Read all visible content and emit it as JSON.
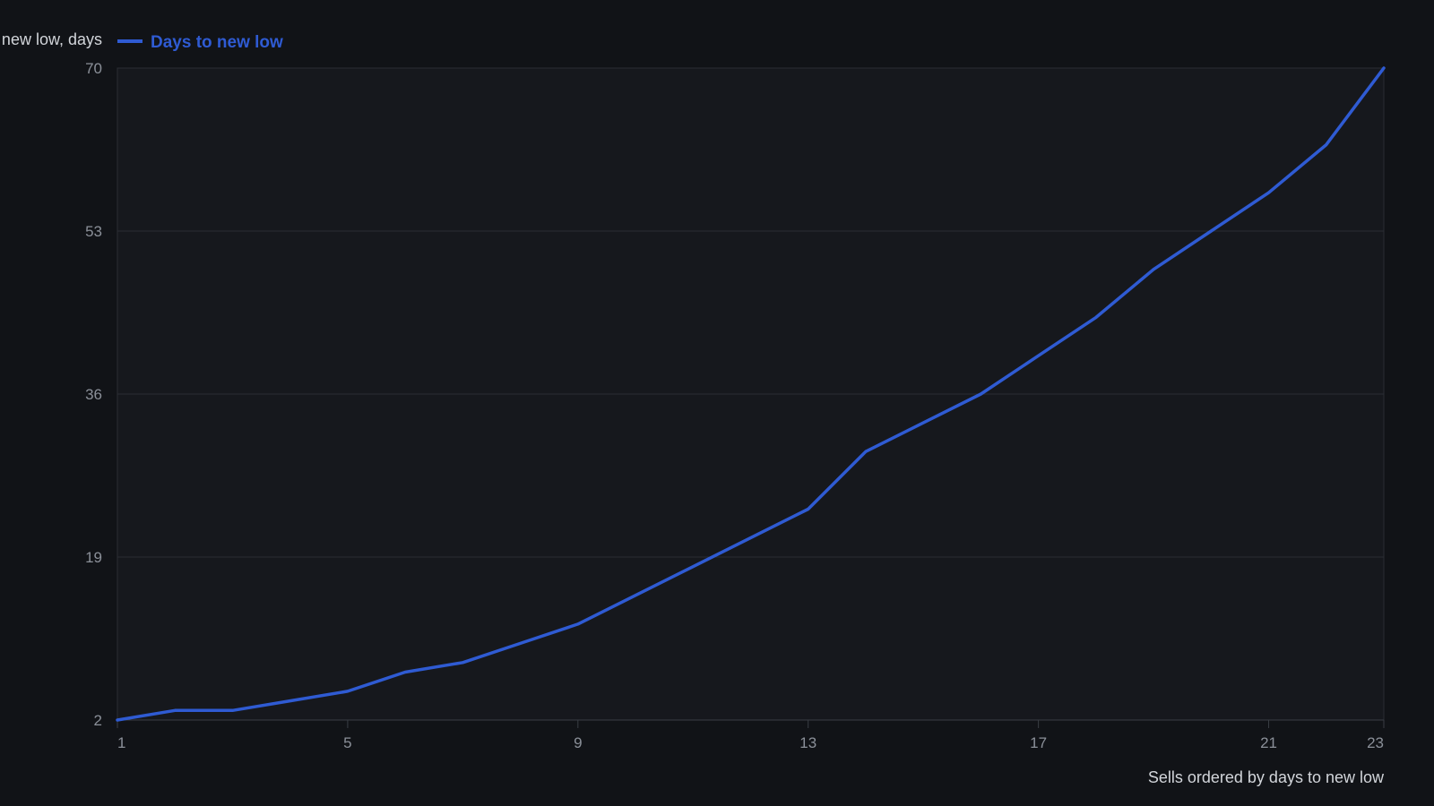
{
  "chart_data": {
    "type": "line",
    "title": "",
    "ylabel": "Days to new low, days",
    "xlabel": "Sells ordered by days to new low",
    "x": [
      1,
      2,
      3,
      4,
      5,
      6,
      7,
      8,
      9,
      10,
      11,
      12,
      13,
      14,
      15,
      16,
      17,
      18,
      19,
      20,
      21,
      22,
      23
    ],
    "series": [
      {
        "name": "Days to new low",
        "color": "#2f5bd3",
        "values": [
          2,
          3,
          3,
          4,
          5,
          7,
          8,
          10,
          12,
          15,
          18,
          21,
          24,
          30,
          33,
          36,
          40,
          44,
          49,
          53,
          57,
          62,
          70
        ]
      }
    ],
    "xticks": [
      1,
      5,
      9,
      13,
      17,
      21,
      23
    ],
    "yticks": [
      2,
      19,
      36,
      53,
      70
    ],
    "xlim": [
      1,
      23
    ],
    "ylim": [
      2,
      70
    ],
    "grid": true,
    "legend_position": "top-left",
    "colors": {
      "background": "#111317",
      "plot_area": "#16181d",
      "grid": "#2a2d33",
      "line": "#2f5bd3"
    }
  }
}
